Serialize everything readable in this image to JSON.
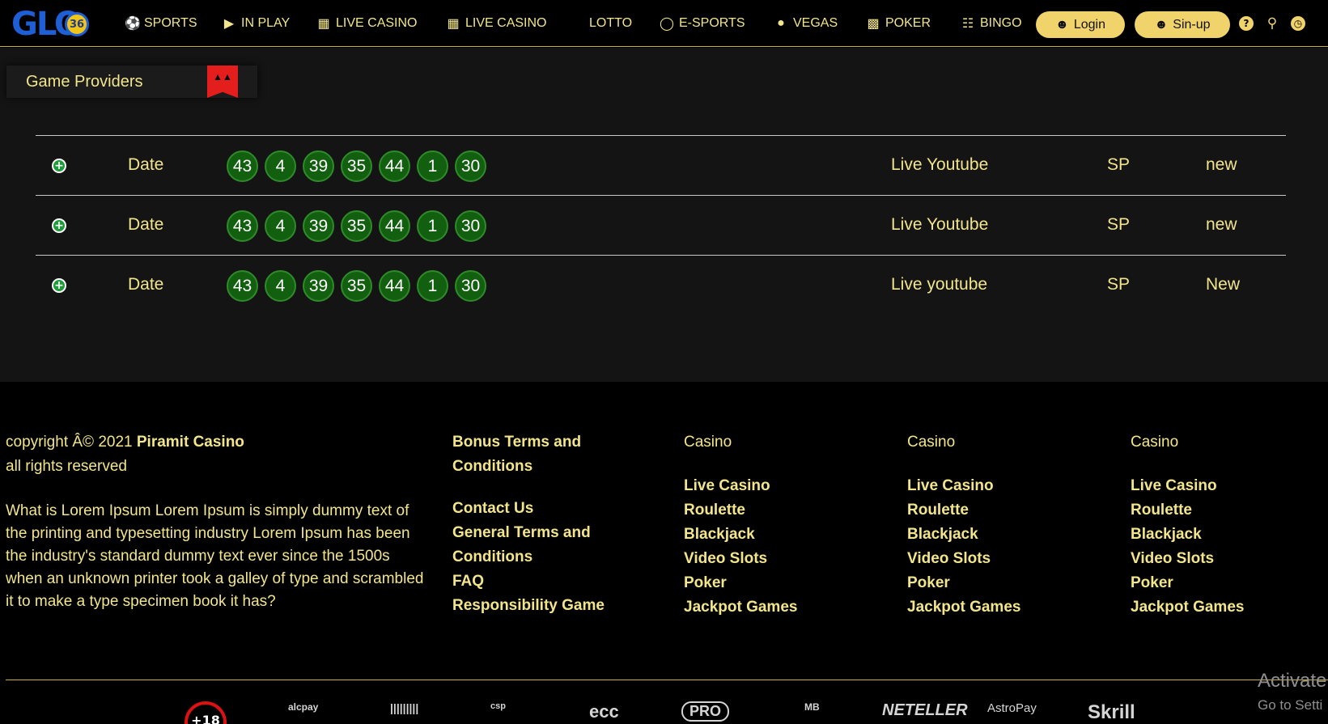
{
  "nav": {
    "logo_text": "GLO",
    "logo_badge": "36",
    "items": [
      {
        "label": "SPORTS",
        "icon": "volleyball-icon"
      },
      {
        "label": "IN PLAY",
        "icon": "play-icon"
      },
      {
        "label": "LIVE CASINO",
        "icon": "calculator-icon"
      },
      {
        "label": "LIVE CASINO",
        "icon": "calculator-icon"
      },
      {
        "label": "LOTTO",
        "icon": ""
      },
      {
        "label": "E-SPORTS",
        "icon": "coins-icon"
      },
      {
        "label": "VEGAS",
        "icon": "apple-icon"
      },
      {
        "label": "POKER",
        "icon": "parking-doc-icon"
      },
      {
        "label": "BINGO",
        "icon": "binoculars-icon"
      }
    ],
    "login_label": "Login",
    "signup_label": "Sin-up",
    "accent": "#f0d36a"
  },
  "providers": {
    "title": "Game Providers"
  },
  "results": [
    {
      "date": "Date",
      "numbers": [
        "43",
        "4",
        "39",
        "35",
        "44",
        "1",
        "30"
      ],
      "live": "Live Youtube",
      "code": "SP",
      "status": "new"
    },
    {
      "date": "Date",
      "numbers": [
        "43",
        "4",
        "39",
        "35",
        "44",
        "1",
        "30"
      ],
      "live": "Live Youtube",
      "code": "SP",
      "status": "new"
    },
    {
      "date": "Date",
      "numbers": [
        "43",
        "4",
        "39",
        "35",
        "44",
        "1",
        "30"
      ],
      "live": "Live youtube",
      "code": "SP",
      "status": "New"
    }
  ],
  "footer": {
    "copyright_prefix": "copyright Â© 2021 ",
    "brand": "Piramit Casino",
    "rights": "all rights reserved",
    "lorem": "What is Lorem Ipsum Lorem Ipsum is simply dummy text of the printing and typesetting industry Lorem Ipsum has been the industry's standard dummy text ever since the 1500s when an unknown printer took a galley of type and scrambled it to make a type specimen book it has?",
    "links_top": "Bonus Terms and Conditions",
    "links": [
      "Contact Us",
      "General Terms and Conditions",
      "FAQ",
      "Responsibility Game"
    ],
    "casino_columns": [
      {
        "head": "Casino",
        "items": [
          "Live Casino",
          "Roulette",
          "Blackjack",
          "Video Slots",
          "Poker",
          "Jackpot Games"
        ]
      },
      {
        "head": "Casino",
        "items": [
          "Live Casino",
          "Roulette",
          "Blackjack",
          "Video Slots",
          "Poker",
          "Jackpot Games"
        ]
      },
      {
        "head": "Casino",
        "items": [
          "Live Casino",
          "Roulette",
          "Blackjack",
          "Video Slots",
          "Poker",
          "Jackpot Games"
        ]
      }
    ],
    "activate_line1": "Activate",
    "activate_line2": "Go to Setti",
    "payment_logos": [
      "+18",
      "alcpay",
      "",
      "csp",
      "ecc",
      "PRO",
      "MB",
      "NETELLER",
      "AstroPay",
      "Skrill"
    ]
  },
  "colors": {
    "text": "#f2e58c",
    "ball_bg": "#12600f",
    "flag": "#e41d1d",
    "plus": "#1f9c3a"
  }
}
